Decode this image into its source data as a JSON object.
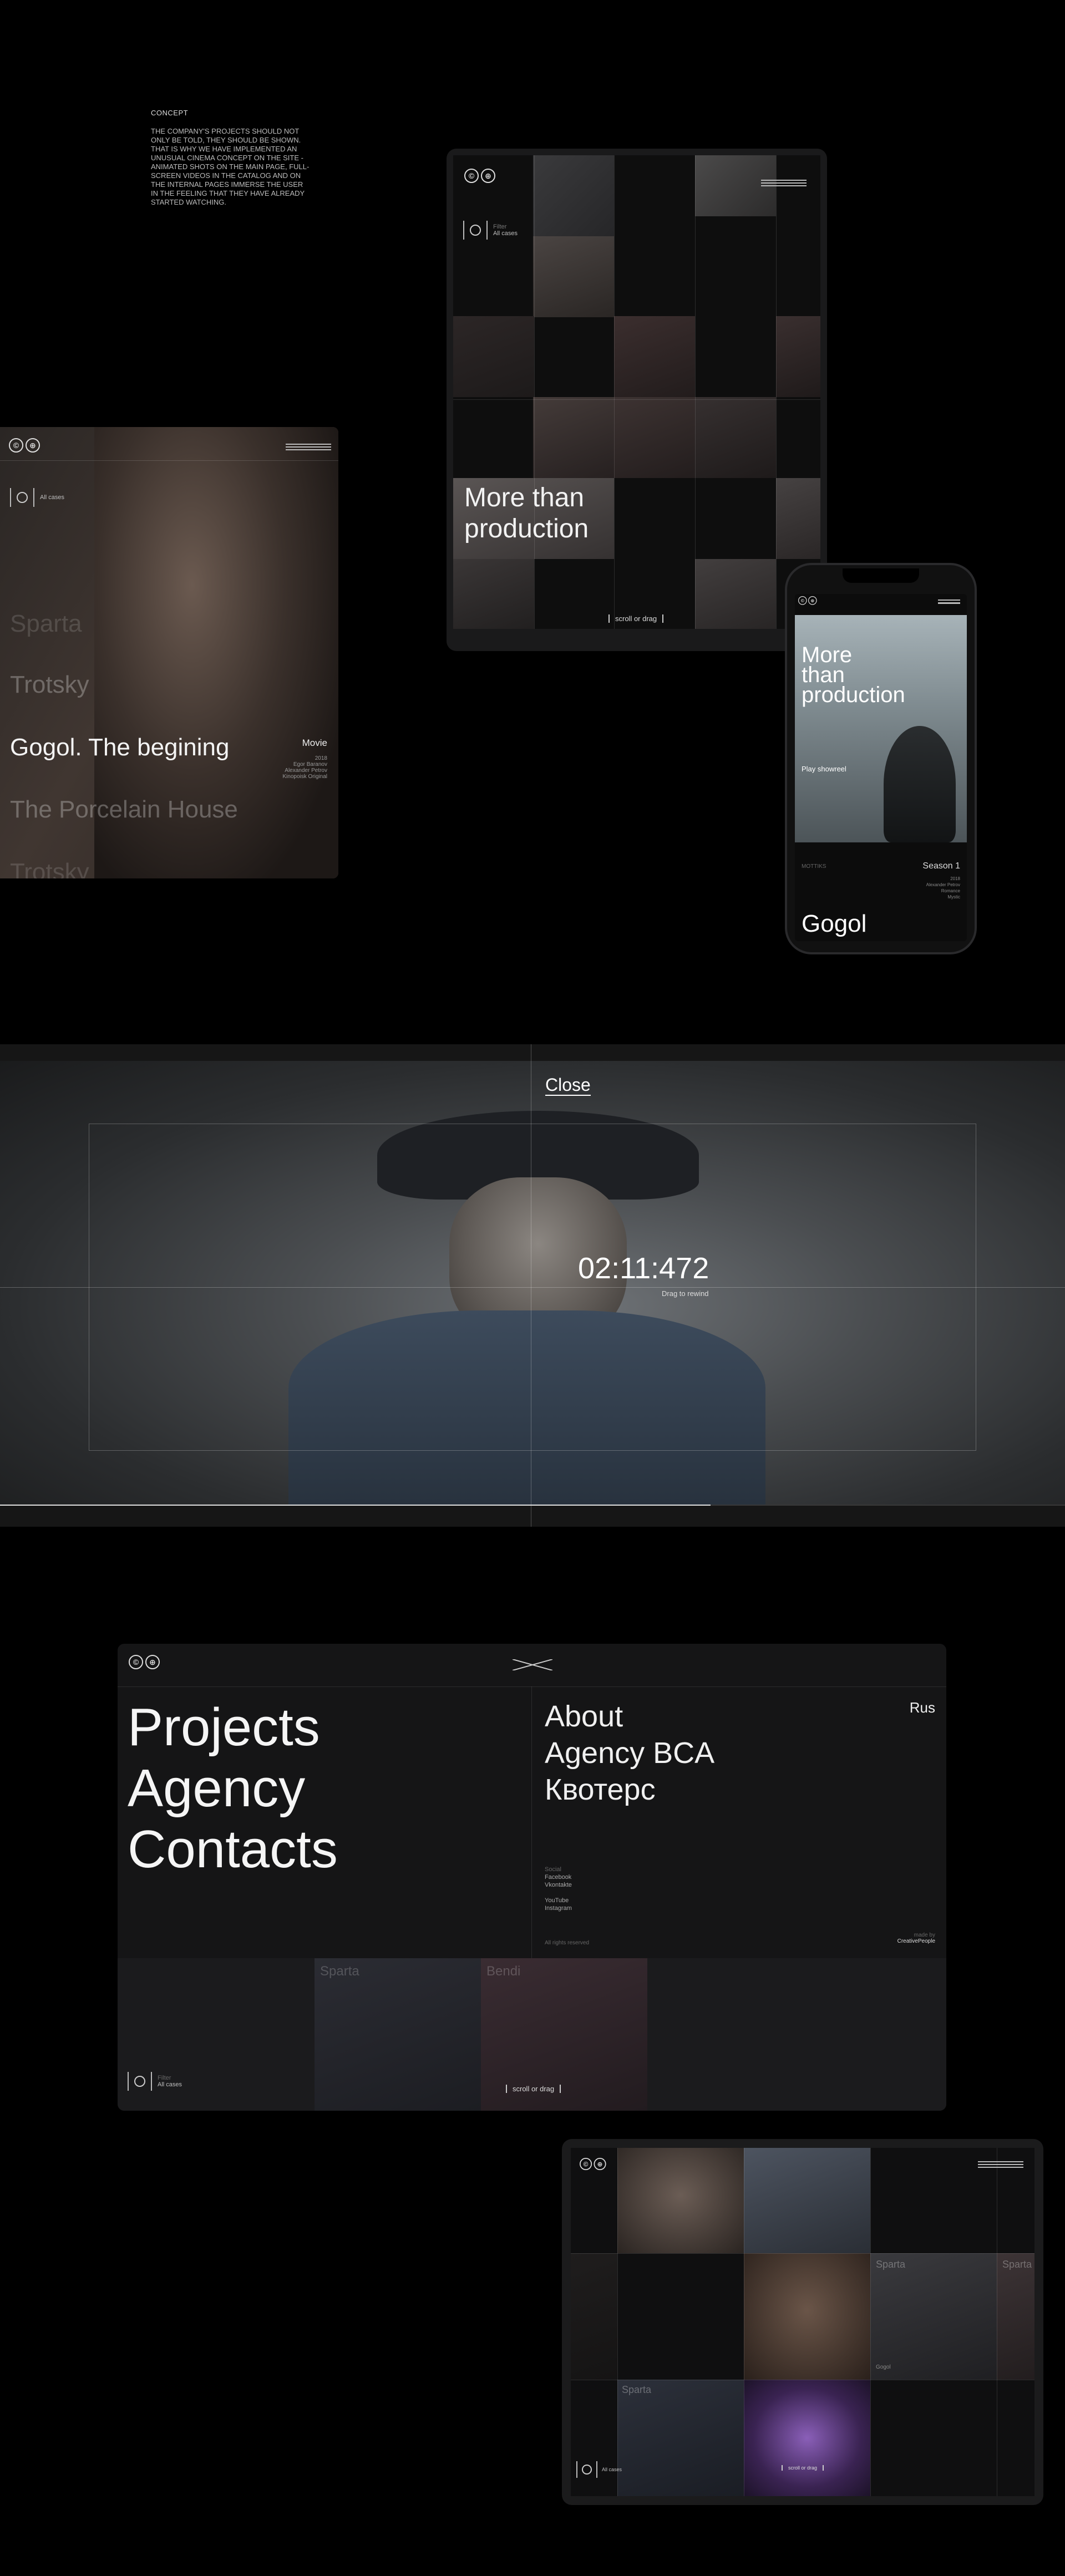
{
  "concept": {
    "heading": "CONCEPT",
    "body": "THE COMPANY'S PROJECTS SHOULD NOT ONLY BE TOLD, THEY SHOULD BE SHOWN. THAT IS WHY WE HAVE IMPLEMENTED AN UNUSUAL CINEMA CONCEPT ON THE SITE - ANIMATED SHOTS ON THE MAIN PAGE, FULL-SCREEN VIDEOS IN THE CATALOG AND ON THE INTERNAL PAGES IMMERSE THE USER IN THE FEELING THAT THEY HAVE ALREADY STARTED WATCHING."
  },
  "tablet_top": {
    "filter_label": "Filter",
    "filter_value": "All cases",
    "headline_1": "More than",
    "headline_2": "production",
    "scroll_hint": "scroll or drag"
  },
  "left_panel": {
    "all_cases": "All cases",
    "items": [
      "Sparta",
      "Trotsky",
      "Gogol. The begining",
      "The Porcelain House",
      "Trotsky"
    ],
    "active_item": "Gogol. The begining",
    "active_meta_title": "Movie",
    "active_meta_lines": [
      "2018",
      "Egor Baranov",
      "Alexander Petrov",
      "Kinopoisk Original"
    ]
  },
  "phone": {
    "headline_1": "More",
    "headline_2": "than",
    "headline_3": "production",
    "play_label": "Play showreel",
    "meta_left": "MOTTIKS",
    "meta_right": "Season 1",
    "meta_lines": [
      "2018",
      "Alexander Petrov",
      "Romance",
      "Mystic"
    ],
    "title": "Gogol"
  },
  "video_player": {
    "close_label": "Close",
    "timecode": "02:11:472",
    "drag_hint": "Drag to rewind",
    "progress": 0.667
  },
  "menu": {
    "primary": [
      "Projects",
      "Agency",
      "Contacts"
    ],
    "secondary": [
      "About",
      "Agency BCA",
      "Квотерс"
    ],
    "language": "Rus",
    "social_group_1_title": "Social",
    "social_group_1": [
      "Facebook",
      "Vkontakte"
    ],
    "social_group_2": [
      "YouTube",
      "Instagram"
    ],
    "rights": "All rights reserved",
    "made_by_label": "made by",
    "made_by": "CreativePeople",
    "filter_label": "Filter",
    "filter_value": "All cases",
    "scroll_hint": "scroll or drag",
    "bg_titles": [
      "Sparta",
      "Bendi"
    ]
  },
  "tablet_bottom": {
    "tile_titles": [
      "Sparta",
      "Sparta",
      "Sparta"
    ],
    "tile_caption": "Gogol",
    "filter_value": "All cases",
    "scroll_hint": "scroll or drag"
  }
}
